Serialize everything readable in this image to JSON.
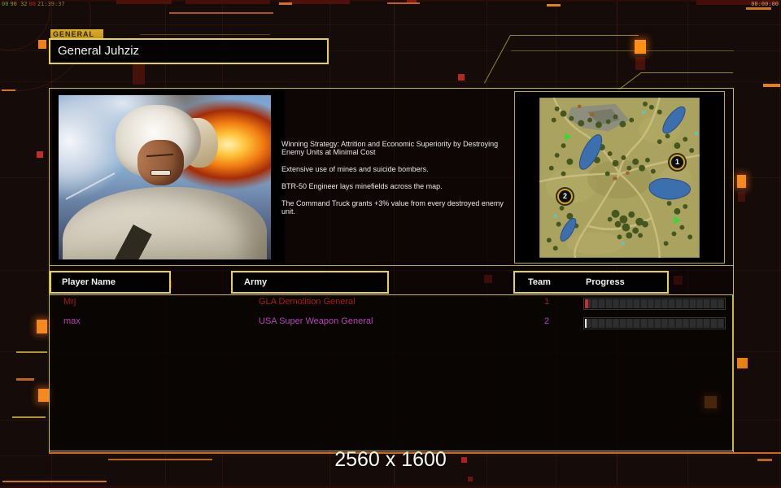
{
  "hud": {
    "debug_left": {
      "seg_green": "00",
      "seg_yellow": "90 32",
      "seg_red": "00",
      "seg_time": "21:39:37"
    },
    "timer_right": "00:00:00"
  },
  "general": {
    "tag": "GENERAL",
    "name": "General Juhziz"
  },
  "strategy": {
    "paragraphs": [
      "Winning Strategy: Attrition and Economic Superiority by Destroying\n Enemy Units at Minimal Cost",
      "Extensive use of mines and suicide bombers.",
      "BTR-50 Engineer lays minefields across the map.",
      "The Command Truck grants +3% value from every destroyed enemy\n unit."
    ]
  },
  "minimap": {
    "markers": [
      {
        "label": "1"
      },
      {
        "label": "2"
      }
    ]
  },
  "table": {
    "headers": {
      "player": "Player Name",
      "army": "Army",
      "team": "Team",
      "progress": "Progress"
    },
    "rows": [
      {
        "player": "Mrj",
        "army": "GLA Demolition General",
        "team": "1",
        "progress_percent": 2
      },
      {
        "player": "max",
        "army": "USA Super Weapon General",
        "team": "2",
        "progress_percent": 1
      }
    ]
  },
  "footer": {
    "resolution_text": "2560 x 1600"
  },
  "colors": {
    "accent_yellow": "#e8d43e",
    "accent_orange": "#f5891d",
    "row1_text": "#a81c15",
    "row2_text": "#b644b8",
    "hud_green": "#58a030",
    "hud_yellow": "#a09020",
    "hud_red": "#b03020"
  }
}
